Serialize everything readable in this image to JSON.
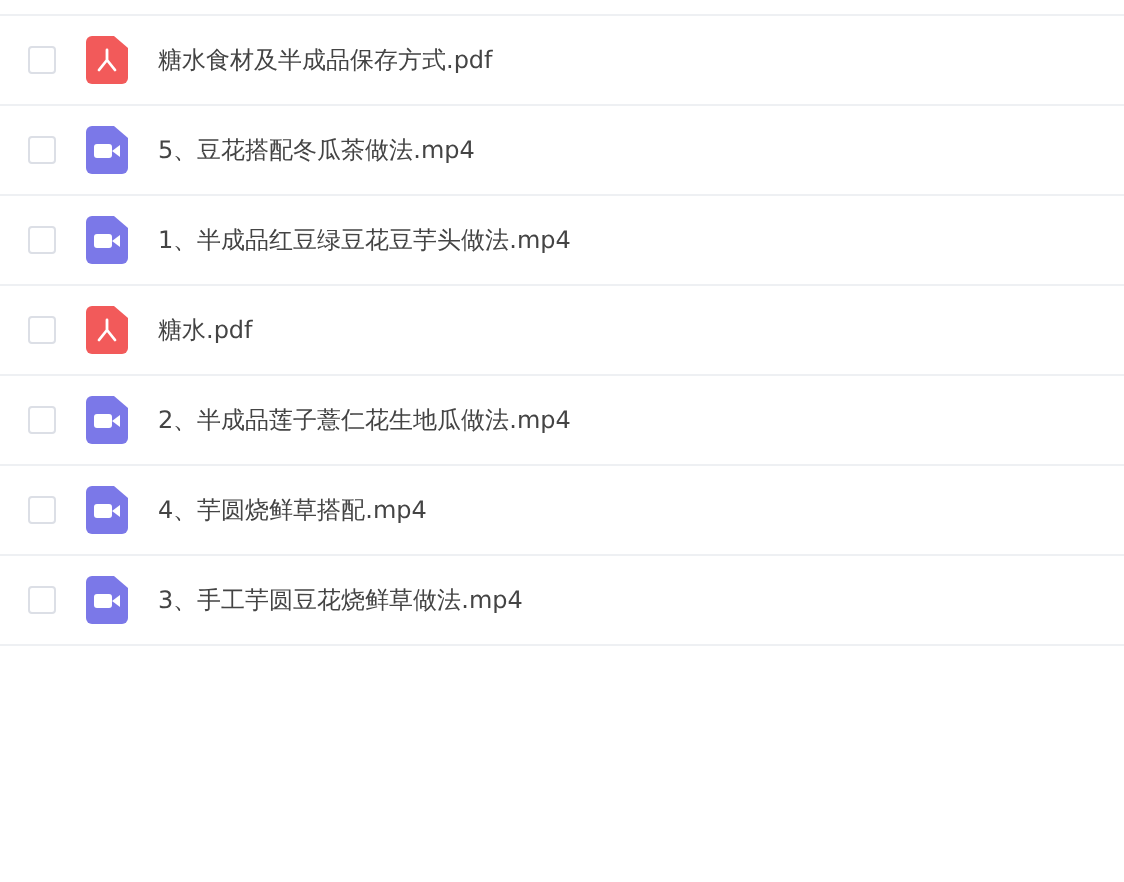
{
  "files": [
    {
      "name": "糖水食材及半成品保存方式.pdf",
      "kind": "pdf",
      "checked": false
    },
    {
      "name": "5、豆花搭配冬瓜茶做法.mp4",
      "kind": "video",
      "checked": false
    },
    {
      "name": "1、半成品红豆绿豆花豆芋头做法.mp4",
      "kind": "video",
      "checked": false
    },
    {
      "name": "糖水.pdf",
      "kind": "pdf",
      "checked": false
    },
    {
      "name": "2、半成品莲子薏仁花生地瓜做法.mp4",
      "kind": "video",
      "checked": false
    },
    {
      "name": "4、芋圆烧鲜草搭配.mp4",
      "kind": "video",
      "checked": false
    },
    {
      "name": "3、手工芋圆豆花烧鲜草做法.mp4",
      "kind": "video",
      "checked": false
    }
  ]
}
